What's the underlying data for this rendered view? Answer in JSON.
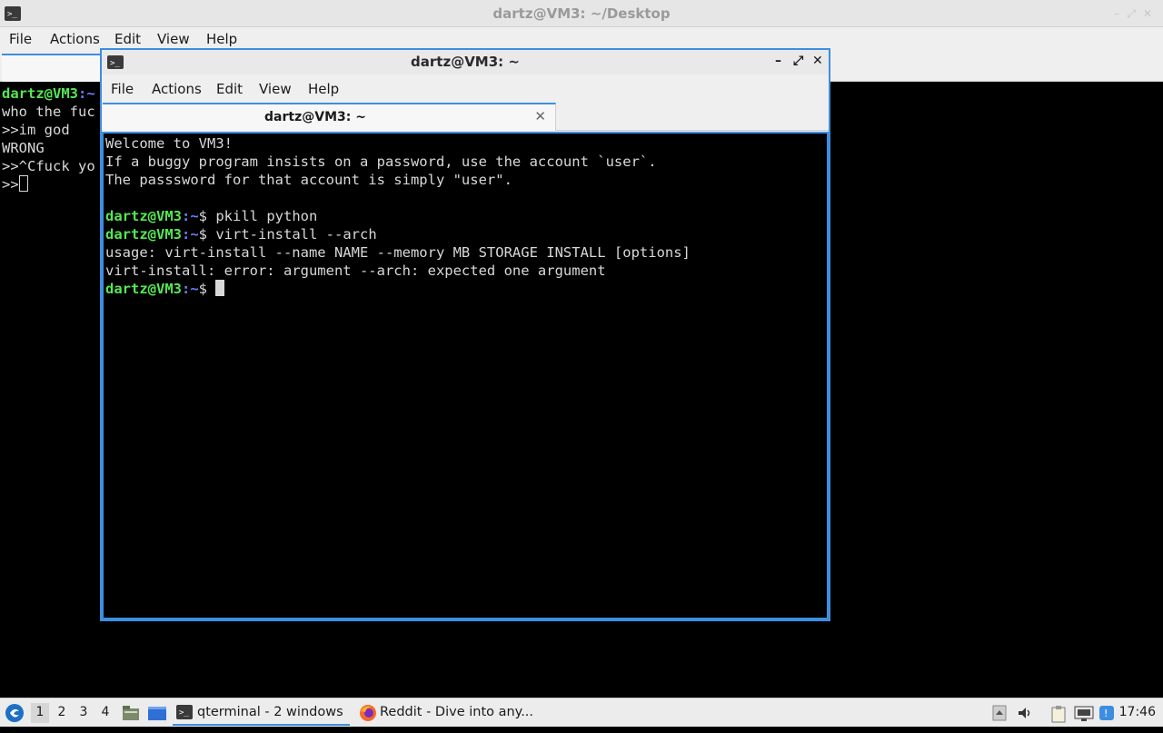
{
  "back_window": {
    "title": "dartz@VM3: ~/Desktop",
    "menu": [
      "File",
      "Actions",
      "Edit",
      "View",
      "Help"
    ],
    "terminal_lines": [
      {
        "user": "dartz@VM3",
        "path": ":~",
        "text": ""
      },
      {
        "text": "who the fuc"
      },
      {
        "text": ">>im god"
      },
      {
        "text": "WRONG"
      },
      {
        "text": ">>^Cfuck yo"
      },
      {
        "text": ">>"
      }
    ]
  },
  "front_window": {
    "title": "dartz@VM3: ~",
    "controls": {
      "minimize": "–",
      "maximize": "⤢",
      "close": "✕"
    },
    "menu": [
      "File",
      "Actions",
      "Edit",
      "View",
      "Help"
    ],
    "tab": {
      "label": "dartz@VM3: ~",
      "close": "✕"
    },
    "terminal": {
      "motd": [
        "Welcome to VM3!",
        "If a buggy program insists on a password, use the account `user`.",
        "The passsword for that account is simply \"user\".",
        ""
      ],
      "prompt_user": "dartz@VM3",
      "prompt_path": ":~",
      "prompt_symbol": "$",
      "commands": [
        {
          "cmd": " pkill python",
          "output": []
        },
        {
          "cmd": " virt-install --arch",
          "output": [
            "usage: virt-install --name NAME --memory MB STORAGE INSTALL [options]",
            "virt-install: error: argument --arch: expected one argument"
          ]
        }
      ]
    }
  },
  "taskbar": {
    "workspaces": [
      "1",
      "2",
      "3",
      "4"
    ],
    "active_workspace": "1",
    "tasks": [
      {
        "label": "qterminal - 2 windows",
        "icon": "terminal-icon",
        "active": true
      },
      {
        "label": "Reddit - Dive into any...",
        "icon": "firefox-icon",
        "active": false
      }
    ],
    "clock": "17:46"
  },
  "colors": {
    "accent": "#3d8ee0",
    "prompt_user": "#54e854",
    "prompt_path": "#6c7cff",
    "terminal_bg": "#000000",
    "terminal_fg": "#d8d8d8"
  }
}
